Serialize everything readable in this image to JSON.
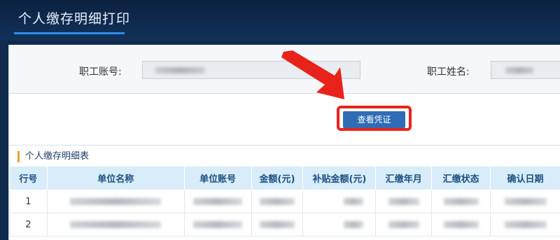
{
  "header": {
    "title": "个人缴存明细打印"
  },
  "form": {
    "account_label": "职工账号:",
    "name_label": "职工姓名:",
    "account_value": "",
    "name_value": ""
  },
  "actions": {
    "view_voucher_label": "查看凭证"
  },
  "table_section": {
    "title": "个人缴存明细表",
    "columns": [
      "行号",
      "单位名称",
      "单位账号",
      "金额(元)",
      "补贴金额(元)",
      "汇缴年月",
      "汇缴状态",
      "确认日期"
    ],
    "rows": [
      {
        "row_no": "1"
      },
      {
        "row_no": "2"
      }
    ]
  },
  "colors": {
    "header_bg": "#12315a",
    "accent_blue": "#2f6cb5",
    "highlight_red": "#e8231b",
    "table_header_bg": "#d8edf9"
  }
}
